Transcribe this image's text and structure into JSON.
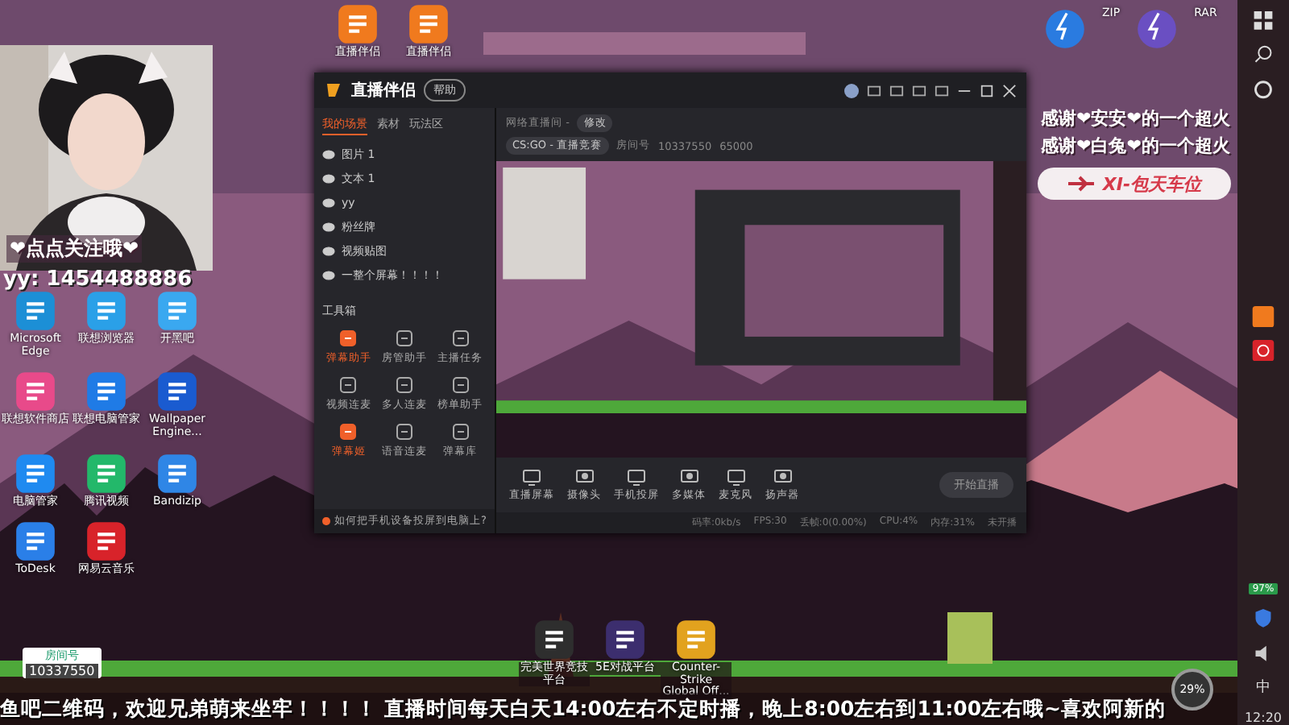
{
  "top_icons": [
    {
      "label": "直播伴侣",
      "color": "#f07a1e"
    },
    {
      "label": "直播伴侣",
      "color": "#f07a1e"
    }
  ],
  "webcam": {
    "caption": "❤点点关注哦❤",
    "id_text": "yy: 1454488886"
  },
  "left_icons": [
    {
      "label": "Microsoft Edge",
      "color": "#1c8fd6"
    },
    {
      "label": "联想浏览器",
      "color": "#2aa0e8"
    },
    {
      "label": "开黑吧",
      "color": "#3aa8f0"
    },
    {
      "label": "联想软件商店",
      "color": "#e84a8a"
    },
    {
      "label": "联想电脑管家",
      "color": "#1f7be6"
    },
    {
      "label": "Wallpaper Engine...",
      "color": "#1a5bd0"
    },
    {
      "label": "电脑管家",
      "color": "#1f8af0"
    },
    {
      "label": "腾讯视频",
      "color": "#23b86a"
    },
    {
      "label": "Bandizip",
      "color": "#2f86e6"
    },
    {
      "label": "ToDesk",
      "color": "#2a7fe8"
    },
    {
      "label": "网易云音乐",
      "color": "#d8232a"
    }
  ],
  "bottom_icons": [
    {
      "label": "完美世界竞技平台",
      "color": "#2e2e2e"
    },
    {
      "label": "5E对战平台",
      "color": "#3c2e6e"
    },
    {
      "label": "Counter-Strike Global Off...",
      "color": "#e2a21e"
    }
  ],
  "top_right_icons": [
    {
      "label": "ZIP",
      "color": "#2a7be0"
    },
    {
      "label": "RAR",
      "color": "#6a4fc2"
    }
  ],
  "app": {
    "title": "直播伴侣",
    "help_button": "帮助",
    "tabs": [
      {
        "label": "我的场景",
        "selected": true
      },
      {
        "label": "素材",
        "selected": false
      },
      {
        "label": "玩法区",
        "selected": false
      }
    ],
    "sources": [
      {
        "name": "图片 1",
        "visible": true
      },
      {
        "name": "文本 1",
        "visible": true
      },
      {
        "name": "yy",
        "visible": true
      },
      {
        "name": "粉丝牌",
        "visible": true
      },
      {
        "name": "视频贴图",
        "visible": true
      },
      {
        "name": "一整个屏幕！！！！",
        "visible": true
      }
    ],
    "toolbox_title": "工具箱",
    "tools": [
      {
        "label": "弹幕助手",
        "active": true
      },
      {
        "label": "房管助手",
        "active": false
      },
      {
        "label": "主播任务",
        "active": false
      },
      {
        "label": "视频连麦",
        "active": false
      },
      {
        "label": "多人连麦",
        "active": false
      },
      {
        "label": "榜单助手",
        "active": false
      },
      {
        "label": "弹幕姬",
        "active": true
      },
      {
        "label": "语音连麦",
        "active": false
      },
      {
        "label": "弹幕库",
        "active": false
      }
    ],
    "hint": "如何把手机设备投屏到电脑上?",
    "room": {
      "name": "网络直播间 -",
      "edit": "修改",
      "category": "CS:GO - 直播竞赛",
      "room_label": "房间号",
      "room_id": "10337550",
      "heat": "65000"
    },
    "controls": [
      "直播屏幕",
      "摄像头",
      "手机投屏",
      "多媒体",
      "麦克风",
      "扬声器"
    ],
    "start_button": "开始直播",
    "status": [
      "码率:0kb/s",
      "FPS:30",
      "丢帧:0(0.00%)",
      "CPU:4%",
      "内存:31%",
      "未开播"
    ]
  },
  "gifts": [
    "感谢❤安安❤的一个超火",
    "感谢❤白兔❤的一个超火"
  ],
  "banner": "XI-包天车位",
  "room_badge": {
    "label": "房间号",
    "number": "10337550"
  },
  "ticker": "鱼吧二维码，欢迎兄弟萌来坐牢！！！！ 直播时间每天白天14:00左右不定时播，晚上8:00左右到11:00左右哦~喜欢阿新的",
  "meter": "29%",
  "taskbar": {
    "battery": "97%",
    "ime": "中",
    "time": "12:20"
  }
}
